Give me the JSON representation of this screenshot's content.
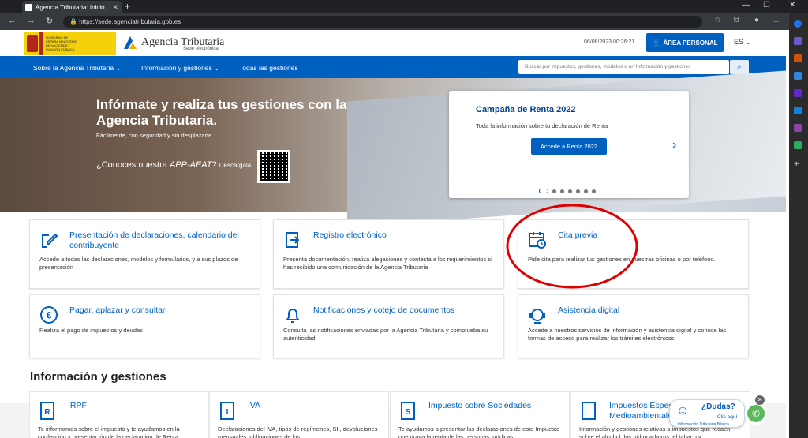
{
  "browser": {
    "tab_title": "Agencia Tributaria: Inicio",
    "url": "https://sede.agenciatributaria.gob.es"
  },
  "header": {
    "gov_text": "GOBIERNO DE ESPAÑA   MINISTERIO DE HACIENDA Y FUNCIÓN PÚBLICA",
    "brand": "Agencia Tributaria",
    "brand_sub": "Sede electrónica",
    "datetime": "06/06/2023 00:26:21",
    "area_personal": "ÁREA PERSONAL",
    "language": "ES"
  },
  "nav": {
    "items": [
      "Sobre la Agencia Tributaria",
      "Información y gestiones",
      "Todas las gestiones"
    ],
    "search_placeholder": "Buscar por impuestos, gestiones, modelos o en Información y gestiones"
  },
  "hero": {
    "title": "Infórmate y realiza tus gestiones con la Agencia Tributaria.",
    "subtitle": "Fácilmente, con seguridad y sin desplazarte.",
    "app_q1": "¿Conoces nuestra ",
    "app_name": "APP-AEAT",
    "app_q2": "? ",
    "app_dl": "Descárgala"
  },
  "slide": {
    "title": "Campaña de Renta 2022",
    "text": "Toda la información sobre tu declaración de Renta",
    "button": "Accede a Renta 2022",
    "slide_count": 7,
    "active_slide": 1
  },
  "cards": [
    {
      "title": "Presentación de declaraciones, calendario del contribuyente",
      "desc": "Accede a todas las declaraciones, modelos y formularios, y a sus plazos de presentación",
      "icon": "pen-form-icon"
    },
    {
      "title": "Registro electrónico",
      "desc": "Presenta documentación, realiza alegaciones y contesta a los requerimientos si has recibido una comunicación de la Agencia Tributaria",
      "icon": "register-arrow-icon"
    },
    {
      "title": "Cita previa",
      "desc": "Pide cita para realizar tus gestiones en nuestras oficinas o por teléfono.",
      "icon": "calendar-clock-icon"
    },
    {
      "title": "Pagar, aplazar y consultar",
      "desc": "Realiza el pago de impuestos y deudas",
      "icon": "euro-icon"
    },
    {
      "title": "Notificaciones y cotejo de documentos",
      "desc": "Consulta las notificaciones enviadas por la Agencia Tributaria y comprueba su autenticidad",
      "icon": "bell-icon"
    },
    {
      "title": "Asistencia digital",
      "desc": "Accede a nuestros servicios de información y asistencia digital y conoce las formas de acceso para realizar los trámites electrónicos",
      "icon": "headset-icon"
    }
  ],
  "info_section": {
    "title": "Información y gestiones",
    "items": [
      {
        "title": "IRPF",
        "letter": "R",
        "desc": "Te informamos sobre el impuesto y te ayudamos en la confección y presentación de la declaración de Renta"
      },
      {
        "title": "IVA",
        "letter": "I",
        "desc": "Declaraciones del IVA, tipos de regímenes, SII, devoluciones mensuales, obligaciones de los"
      },
      {
        "title": "Impuesto sobre Sociedades",
        "letter": "S",
        "desc": "Te ayudamos a presentar las declaraciones de este Impuesto que grava la renta de las personas jurídicas"
      },
      {
        "title": "Impuestos Especiales y Medioambientales",
        "letter": "",
        "desc": "Información y gestiones relativas a impuestos que recaen sobre el alcohol, los hidrocarburos, el tabaco y"
      }
    ]
  },
  "chat": {
    "title": "¿Dudas?",
    "link": "Clic aquí",
    "sub": "Información Tributaria Básica"
  },
  "colors": {
    "primary": "#0060c0",
    "annotation": "#e00000"
  }
}
